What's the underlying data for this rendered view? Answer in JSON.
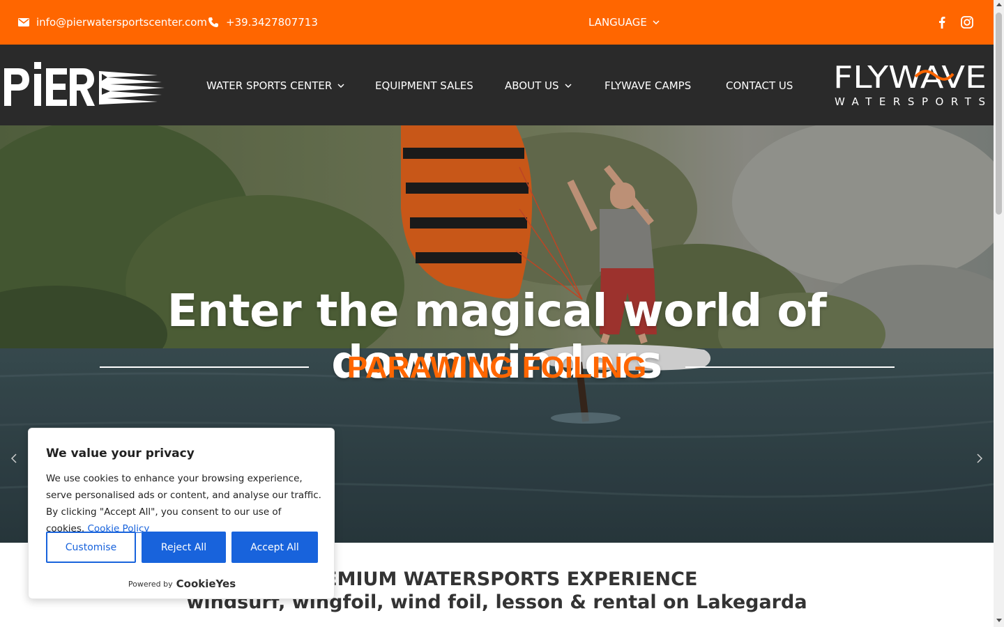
{
  "topbar": {
    "email": "info@pierwatersportscenter.com",
    "phone": "+39.3427807713",
    "language": "LANGUAGE",
    "social": [
      "facebook-icon",
      "instagram-icon"
    ],
    "bg_color": "#ff6600"
  },
  "header": {
    "logo_text": "PIER",
    "nav": [
      {
        "label": "WATER SPORTS CENTER",
        "dropdown": true
      },
      {
        "label": "EQUIPMENT SALES",
        "dropdown": false
      },
      {
        "label": "ABOUT US",
        "dropdown": true
      },
      {
        "label": "FLYWAVE CAMPS",
        "dropdown": false
      },
      {
        "label": "CONTACT US",
        "dropdown": false
      }
    ],
    "partner_logo": {
      "line1": "FLYWAVE",
      "line2": "WATERSPORTS"
    },
    "bg_color": "#2a2a2a"
  },
  "hero": {
    "title": "Enter the magical world of downwinders",
    "subtitle": "PARAWING FOILING",
    "accent_color": "#ff6600"
  },
  "section": {
    "title": "PREMIUM WATERSPORTS EXPERIENCE",
    "subtitle": "windsurf, wingfoil, wind foil, lesson & rental on Lakegarda"
  },
  "cookie": {
    "title": "We value your privacy",
    "text": "We use cookies to enhance your browsing experience, serve personalised ads or content, and analyse our traffic. By clicking \"Accept All\", you consent to our use of cookies.",
    "link": "Cookie Policy",
    "customise": "Customise",
    "reject": "Reject All",
    "accept": "Accept All",
    "powered_by": "Powered by",
    "brand": "CookieYes",
    "accent_color": "#1863dc"
  }
}
